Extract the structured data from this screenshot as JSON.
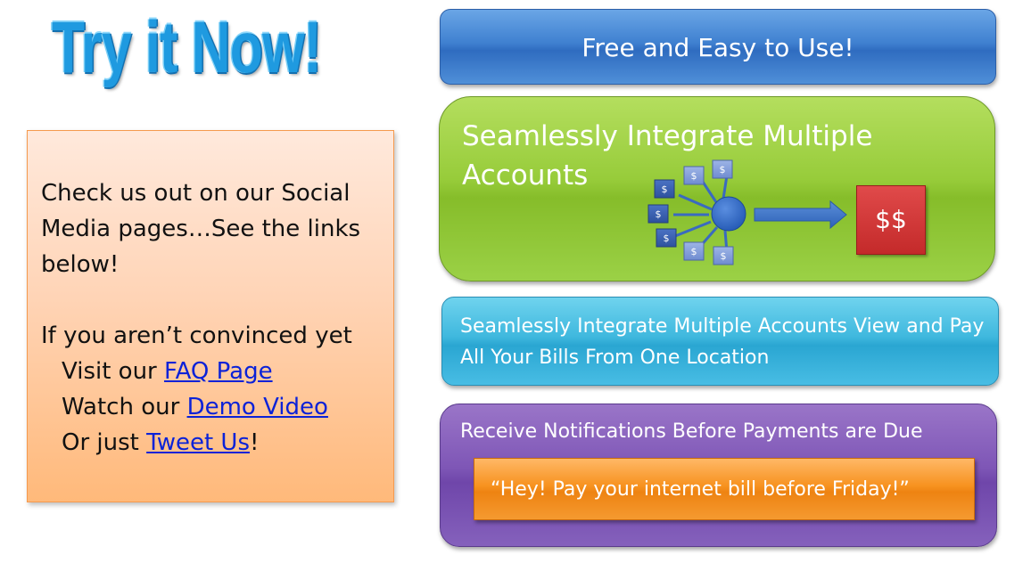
{
  "headline": "Try it Now!",
  "sidebar": {
    "intro": "Check us out on our Social Media pages…See the links below!",
    "convince_line": "If you aren’t convinced yet",
    "faq": {
      "prefix": "Visit our ",
      "link": "FAQ Page",
      "suffix": ""
    },
    "demo": {
      "prefix": "Watch our ",
      "link": "Demo Video",
      "suffix": ""
    },
    "tweet": {
      "prefix": "Or just ",
      "link": "Tweet Us",
      "suffix": "!"
    }
  },
  "panels": {
    "free": "Free and Easy to Use!",
    "integrate_title": "Seamlessly Integrate Multiple Accounts",
    "integrate_total": "$$",
    "coin_label": "$",
    "view_pay": "Seamlessly Integrate Multiple Accounts View and Pay All Your Bills From One Location",
    "notifications_title": "Receive Notifications Before Payments are Due",
    "notification_example": "“Hey! Pay your internet bill before Friday!”"
  },
  "colors": {
    "headline": "#1f9ae0",
    "link": "#0b22d8",
    "blue_panel": "#3f80d0",
    "green_panel": "#97cc3a",
    "cyan_panel": "#3fb8de",
    "purple_panel": "#7e56b6",
    "orange_callout": "#f7921f",
    "red_total": "#c42a2a"
  }
}
